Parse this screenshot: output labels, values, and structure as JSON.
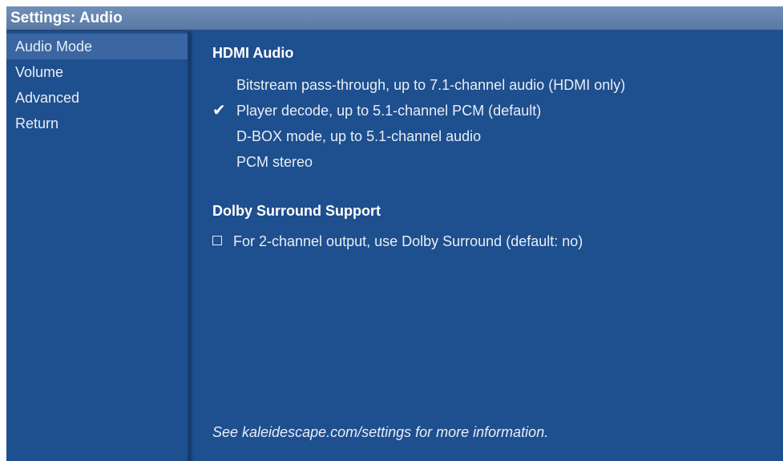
{
  "window": {
    "title": "Settings: Audio"
  },
  "sidebar": {
    "items": [
      {
        "label": "Audio Mode",
        "active": true
      },
      {
        "label": "Volume",
        "active": false
      },
      {
        "label": "Advanced",
        "active": false
      },
      {
        "label": "Return",
        "active": false
      }
    ]
  },
  "main": {
    "hdmi_section": {
      "heading": "HDMI Audio",
      "options": [
        {
          "label": "Bitstream pass-through, up to 7.1-channel audio (HDMI only)",
          "selected": false
        },
        {
          "label": "Player decode, up to 5.1-channel PCM (default)",
          "selected": true
        },
        {
          "label": "D-BOX mode, up to 5.1-channel audio",
          "selected": false
        },
        {
          "label": "PCM stereo",
          "selected": false
        }
      ]
    },
    "dolby_section": {
      "heading": "Dolby Surround Support",
      "checkbox": {
        "label": "For 2-channel output, use Dolby Surround (default: no)",
        "checked": false
      }
    },
    "footer_note": "See kaleidescape.com/settings for more information."
  },
  "icons": {
    "selected_mark": "checkmark-icon",
    "checkbox": "checkbox-icon"
  },
  "colors": {
    "background": "#1e4f8e",
    "title_bar": "#6f8fb8",
    "sidebar_active": "#3b66a2",
    "text": "#e8eef7"
  }
}
